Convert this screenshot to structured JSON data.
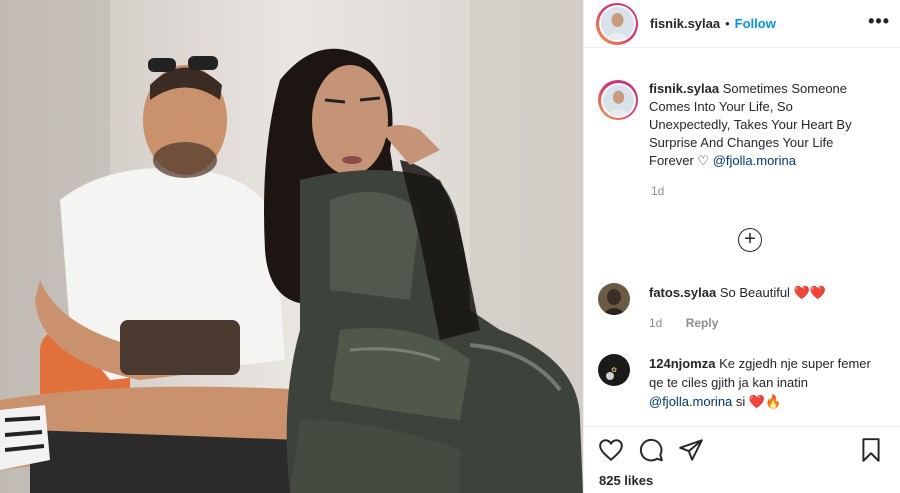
{
  "header": {
    "username": "fisnik.sylaa",
    "separator": "•",
    "follow_label": "Follow",
    "more_label": "•••"
  },
  "caption": {
    "username": "fisnik.sylaa",
    "text": "Sometimes Someone Comes Into Your Life, So Unexpectedly, Takes Your Heart By Surprise And Changes Your Life Forever",
    "heart": "♡",
    "mention": "@fjolla.morina",
    "time": "1d"
  },
  "load_more_label": "+",
  "comments": [
    {
      "username": "fatos.sylaa",
      "text": "So Beautiful",
      "emoji": "❤️❤️",
      "time": "1d",
      "reply_label": "Reply"
    },
    {
      "username": "124njomza",
      "text": "Ke zgjedh nje super femer qe te ciles gjith ja kan inatin",
      "mention": "@fjolla.morina",
      "suffix": "si",
      "emoji": "❤️🔥"
    }
  ],
  "likes": "825 likes",
  "colors": {
    "accent": "#0095f6",
    "mention": "#00376b",
    "muted": "#8e8e8e",
    "heart": "#ed4956"
  },
  "icons": [
    "like-icon",
    "comment-icon",
    "share-icon",
    "save-icon"
  ]
}
